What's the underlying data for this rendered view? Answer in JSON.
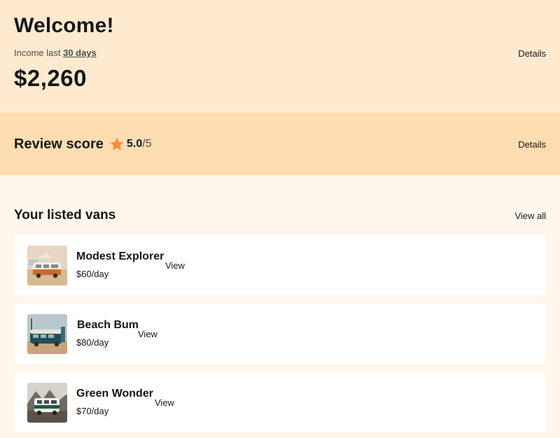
{
  "income": {
    "title": "Welcome!",
    "subtitle_prefix": "Income last",
    "period_link": "30 days",
    "amount": "$2,260",
    "details_label": "Details"
  },
  "review": {
    "title": "Review score",
    "score_value": "5.0",
    "score_max": "/5",
    "star_color": "#ff8c38",
    "details_label": "Details"
  },
  "vans": {
    "title": "Your listed vans",
    "view_all_label": "View all",
    "items": [
      {
        "name": "Modest Explorer",
        "price": "$60/day",
        "view_label": "View"
      },
      {
        "name": "Beach Bum",
        "price": "$80/day",
        "view_label": "View"
      },
      {
        "name": "Green Wonder",
        "price": "$70/day",
        "view_label": "View"
      }
    ]
  },
  "colors": {
    "income_bg": "#ffead0",
    "review_bg": "#ffddb2",
    "page_bg": "#fff7ed"
  }
}
